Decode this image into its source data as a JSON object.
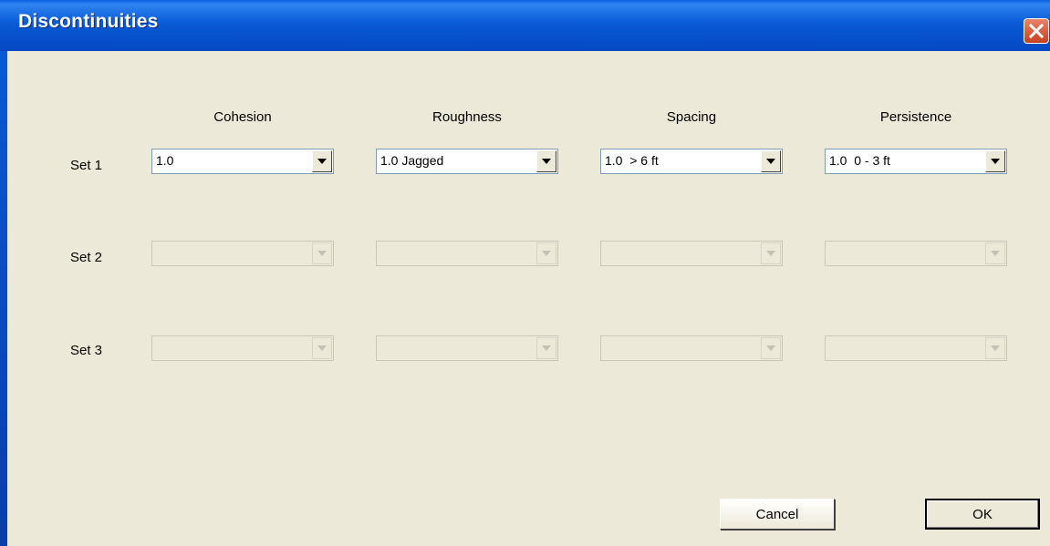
{
  "window": {
    "title": "Discontinuities"
  },
  "columns": [
    "Cohesion",
    "Roughness",
    "Spacing",
    "Persistence"
  ],
  "rows": [
    {
      "label": "Set 1",
      "enabled": true,
      "values": [
        "1.0",
        "1.0 Jagged",
        "1.0  > 6 ft",
        "1.0  0 - 3 ft"
      ]
    },
    {
      "label": "Set 2",
      "enabled": false,
      "values": [
        "",
        "",
        "",
        ""
      ]
    },
    {
      "label": "Set 3",
      "enabled": false,
      "values": [
        "",
        "",
        "",
        ""
      ]
    }
  ],
  "buttons": {
    "cancel": "Cancel",
    "ok": "OK"
  },
  "colors": {
    "titlebar": "#0a5ad6",
    "dialog_bg": "#ece9d8",
    "close": "#c7401e"
  }
}
